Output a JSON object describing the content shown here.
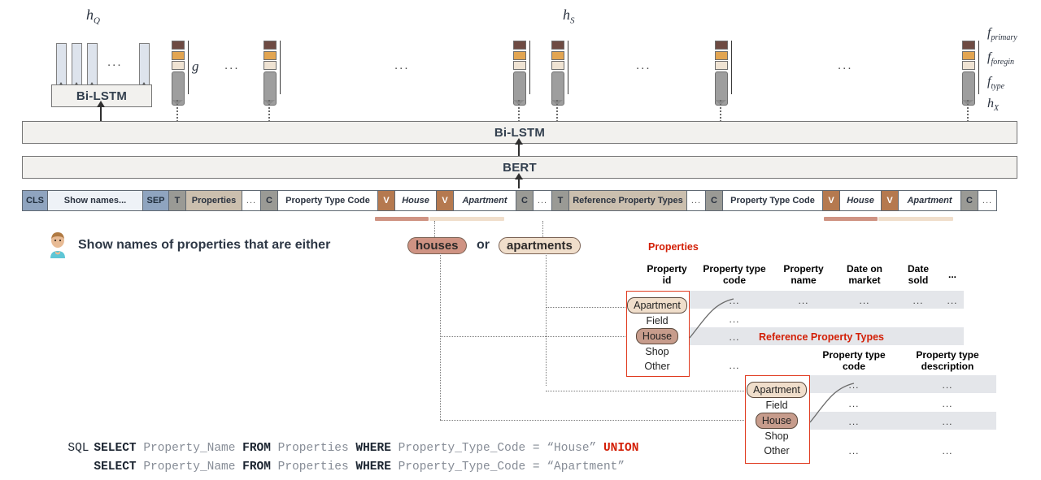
{
  "figure": {
    "labels": {
      "h_q": "h",
      "h_q_sub": "Q",
      "h_s": "h",
      "h_s_sub": "S",
      "g": "g",
      "f_primary": "f",
      "f_primary_sub": "primary",
      "f_foregin": "f",
      "f_foregin_sub": "foregin",
      "f_type": "f",
      "f_type_sub": "type",
      "h_x": "h",
      "h_x_sub": "X",
      "ellipsis": "..."
    },
    "layers": {
      "bilstm_small": "Bi-LSTM",
      "bilstm_wide": "Bi-LSTM",
      "bert": "BERT"
    },
    "tokens": [
      {
        "text": "CLS",
        "style": "t-cls"
      },
      {
        "text": "Show names...",
        "style": "t-q"
      },
      {
        "text": "SEP",
        "style": "t-cls"
      },
      {
        "text": "T",
        "style": "t-gray"
      },
      {
        "text": "Properties",
        "style": "t-tbl"
      },
      {
        "text": "...",
        "style": "t-dots"
      },
      {
        "text": "C",
        "style": "t-gray"
      },
      {
        "text": "Property Type Code",
        "style": "t-white"
      },
      {
        "text": "V",
        "style": "t-val"
      },
      {
        "text": "House",
        "style": "t-ital"
      },
      {
        "text": "V",
        "style": "t-val"
      },
      {
        "text": "Apartment",
        "style": "t-ital"
      },
      {
        "text": "C",
        "style": "t-gray"
      },
      {
        "text": "...",
        "style": "t-dots"
      },
      {
        "text": "T",
        "style": "t-gray"
      },
      {
        "text": "Reference Property Types",
        "style": "t-tbl"
      },
      {
        "text": "...",
        "style": "t-dots"
      },
      {
        "text": "C",
        "style": "t-gray"
      },
      {
        "text": "Property Type Code",
        "style": "t-white"
      },
      {
        "text": "V",
        "style": "t-val"
      },
      {
        "text": "House",
        "style": "t-ital"
      },
      {
        "text": "V",
        "style": "t-val"
      },
      {
        "text": "Apartment",
        "style": "t-ital"
      },
      {
        "text": "C",
        "style": "t-gray"
      },
      {
        "text": "...",
        "style": "t-dots"
      }
    ],
    "question": {
      "part1": "Show  names  of  properties  that  are  either",
      "pill_house": "houses",
      "joiner": "or",
      "pill_apartment": "apartments"
    },
    "tables": [
      {
        "title": "Properties",
        "columns": [
          "Property\nid",
          "Property type\ncode",
          "Property\nname",
          "Date on\nmarket",
          "Date\nsold",
          "..."
        ],
        "cell_placeholder": "...",
        "values": [
          "Apartment",
          "Field",
          "House",
          "Shop",
          "Other"
        ]
      },
      {
        "title": "Reference Property Types",
        "columns": [
          "Property type\ncode",
          "Property type\ndescription"
        ],
        "cell_placeholder": "...",
        "values": [
          "Apartment",
          "Field",
          "House",
          "Shop",
          "Other"
        ]
      }
    ],
    "sql": {
      "prefix": "SQL",
      "line1": [
        {
          "t": "SELECT ",
          "c": "kw"
        },
        {
          "t": "Property_Name ",
          "c": "id"
        },
        {
          "t": "FROM ",
          "c": "kw"
        },
        {
          "t": "Properties ",
          "c": "id"
        },
        {
          "t": "WHERE ",
          "c": "kw"
        },
        {
          "t": "Property_Type_Code = “House” ",
          "c": "id"
        },
        {
          "t": "UNION",
          "c": "union"
        }
      ],
      "line2": [
        {
          "t": "SELECT ",
          "c": "kw"
        },
        {
          "t": "Property_Name ",
          "c": "id"
        },
        {
          "t": "FROM ",
          "c": "kw"
        },
        {
          "t": "Properties ",
          "c": "id"
        },
        {
          "t": "WHERE ",
          "c": "kw"
        },
        {
          "t": "Property_Type_Code = “Apartment”",
          "c": "id"
        }
      ]
    },
    "colors": {
      "primary_swatch": "#6e4b43",
      "foreign_swatch": "#e2a552",
      "type_swatch": "#efe3d3",
      "value_token": "#b5794f",
      "table_token": "#cbbfae",
      "cls_token": "#8fa4bf",
      "table_title": "#d31f06",
      "house_pill": "#cf9383",
      "apartment_pill": "#f0decb",
      "redbox_border": "#e03b20"
    }
  }
}
